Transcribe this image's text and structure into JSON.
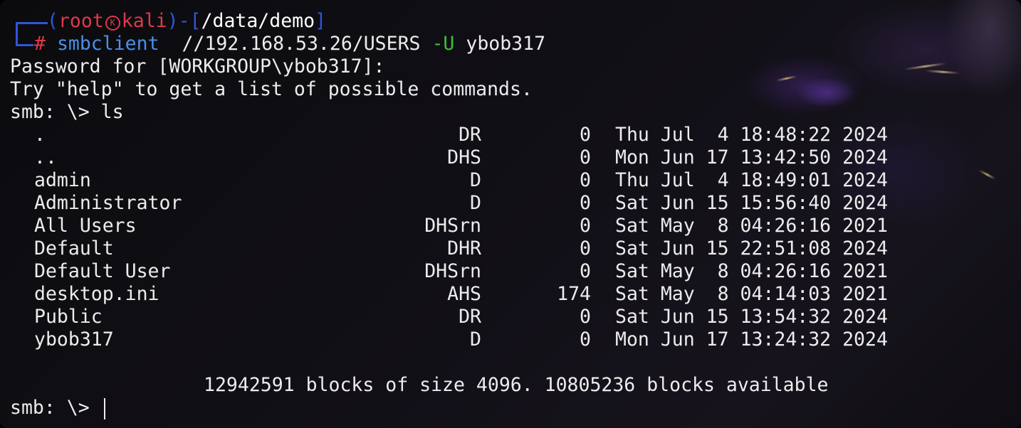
{
  "prompt": {
    "open_paren": "(",
    "user": "root",
    "host": "kali",
    "close_paren": ")",
    "dash": "-",
    "open_bracket": "[",
    "cwd": "/data/demo",
    "close_bracket": "]",
    "hash": "#"
  },
  "command": {
    "program": "smbclient",
    "target": "//192.168.53.26/USERS",
    "flag": "-U",
    "user_arg": "ybob317"
  },
  "output": {
    "password_line": "Password for [WORKGROUP\\ybob317]:",
    "help_line": "Try \"help\" to get a list of possible commands.",
    "ls_prompt": "smb: \\> ls",
    "listing": [
      {
        "name": ".",
        "attr": "DR",
        "size": "0",
        "date": "Thu Jul  4 18:48:22 2024"
      },
      {
        "name": "..",
        "attr": "DHS",
        "size": "0",
        "date": "Mon Jun 17 13:42:50 2024"
      },
      {
        "name": "admin",
        "attr": "D",
        "size": "0",
        "date": "Thu Jul  4 18:49:01 2024"
      },
      {
        "name": "Administrator",
        "attr": "D",
        "size": "0",
        "date": "Sat Jun 15 15:56:40 2024"
      },
      {
        "name": "All Users",
        "attr": "DHSrn",
        "size": "0",
        "date": "Sat May  8 04:26:16 2021"
      },
      {
        "name": "Default",
        "attr": "DHR",
        "size": "0",
        "date": "Sat Jun 15 22:51:08 2024"
      },
      {
        "name": "Default User",
        "attr": "DHSrn",
        "size": "0",
        "date": "Sat May  8 04:26:16 2021"
      },
      {
        "name": "desktop.ini",
        "attr": "AHS",
        "size": "174",
        "date": "Sat May  8 04:14:03 2021"
      },
      {
        "name": "Public",
        "attr": "DR",
        "size": "0",
        "date": "Sat Jun 15 13:54:32 2024"
      },
      {
        "name": "ybob317",
        "attr": "D",
        "size": "0",
        "date": "Mon Jun 17 13:24:32 2024"
      }
    ],
    "blocks_line": "12942591 blocks of size 4096. 10805236 blocks available",
    "final_prompt": "smb: \\>"
  },
  "colors": {
    "bracket_blue": "#2f56d8",
    "root_red": "#e0384a",
    "command_blue": "#4b8fe8",
    "flag_green": "#39c233",
    "text": "#ececec"
  }
}
